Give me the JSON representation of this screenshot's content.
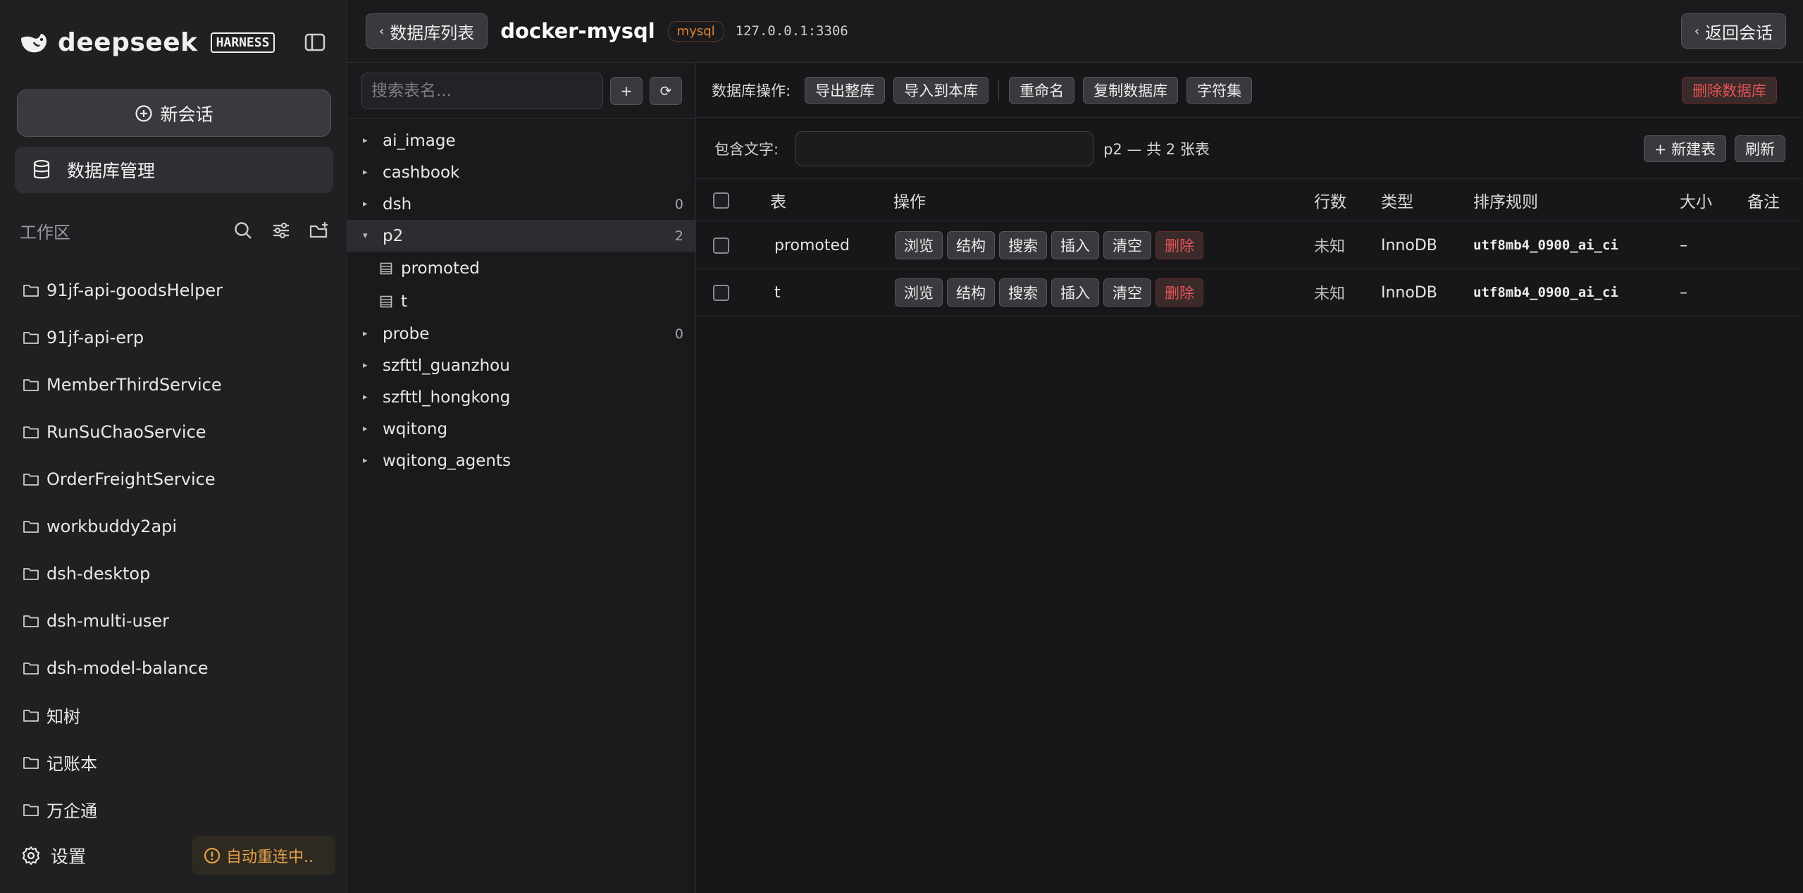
{
  "sidebar": {
    "brand_name": "deepseek",
    "brand_badge": "HARNESS",
    "new_chat": "新会话",
    "db_manage": "数据库管理",
    "workspace_label": "工作区",
    "workspaces": [
      "91jf-api-goodsHelper",
      "91jf-api-erp",
      "MemberThirdService",
      "RunSuChaoService",
      "OrderFreightService",
      "workbuddy2api",
      "dsh-desktop",
      "dsh-multi-user",
      "dsh-model-balance",
      "知树",
      "记账本",
      "万企通"
    ],
    "settings": "设置",
    "reconnect": "自动重连中.."
  },
  "topbar": {
    "back_label": "数据库列表",
    "conn_name": "docker-mysql",
    "engine_tag": "mysql",
    "host": "127.0.0.1:3306",
    "return_label": "返回会话"
  },
  "tree": {
    "search_placeholder": "搜索表名...",
    "add_label": "+",
    "refresh_label": "⟳",
    "nodes": [
      {
        "name": "ai_image",
        "count": ""
      },
      {
        "name": "cashbook",
        "count": ""
      },
      {
        "name": "dsh",
        "count": "0"
      },
      {
        "name": "p2",
        "count": "2"
      },
      {
        "name": "probe",
        "count": "0"
      },
      {
        "name": "szfttl_guanzhou",
        "count": ""
      },
      {
        "name": "szfttl_hongkong",
        "count": ""
      },
      {
        "name": "wqitong",
        "count": ""
      },
      {
        "name": "wqitong_agents",
        "count": ""
      }
    ],
    "p2_children": [
      "promoted",
      "t"
    ]
  },
  "ops": {
    "label": "数据库操作:",
    "export": "导出整库",
    "import": "导入到本库",
    "rename": "重命名",
    "copy": "复制数据库",
    "charset": "字符集",
    "delete": "删除数据库"
  },
  "filter": {
    "label": "包含文字:",
    "info": "p2 — 共 2 张表",
    "new_table": "+ 新建表",
    "refresh": "刷新"
  },
  "table": {
    "headers": {
      "table": "表",
      "ops": "操作",
      "rows": "行数",
      "type": "类型",
      "collation": "排序规则",
      "size": "大小",
      "note": "备注"
    },
    "action_labels": {
      "browse": "浏览",
      "structure": "结构",
      "search": "搜索",
      "insert": "插入",
      "empty": "清空",
      "delete": "删除"
    },
    "rows": [
      {
        "name": "promoted",
        "rows": "未知",
        "type": "InnoDB",
        "collation": "utf8mb4_0900_ai_ci",
        "size": "–",
        "note": ""
      },
      {
        "name": "t",
        "rows": "未知",
        "type": "InnoDB",
        "collation": "utf8mb4_0900_ai_ci",
        "size": "–",
        "note": ""
      }
    ]
  }
}
